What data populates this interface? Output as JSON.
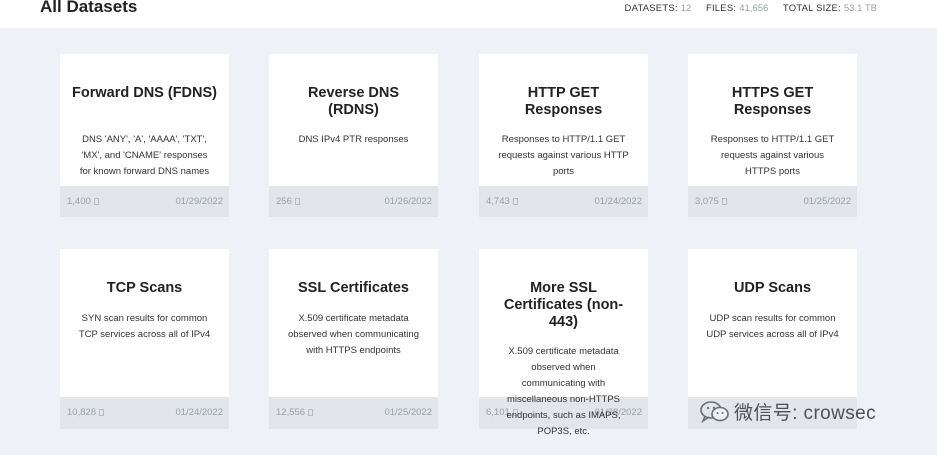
{
  "header": {
    "title": "All Datasets",
    "stats": [
      {
        "label": "DATASETS:",
        "value": "12"
      },
      {
        "label": "FILES:",
        "value": "41,656"
      },
      {
        "label": "TOTAL SIZE:",
        "value": "53.1 TB"
      }
    ]
  },
  "cards": [
    {
      "title": "Forward DNS (FDNS)",
      "description": "DNS 'ANY', 'A', 'AAAA', 'TXT', 'MX', and 'CNAME' responses for known forward DNS names",
      "files": "1,400",
      "date": "01/29/2022"
    },
    {
      "title": "Reverse DNS (RDNS)",
      "description": "DNS IPv4 PTR responses",
      "files": "256",
      "date": "01/26/2022"
    },
    {
      "title": "HTTP GET Responses",
      "description": "Responses to HTTP/1.1 GET requests against various HTTP ports",
      "files": "4,743",
      "date": "01/24/2022"
    },
    {
      "title": "HTTPS GET Responses",
      "description": "Responses to HTTP/1.1 GET requests against various HTTPS ports",
      "files": "3,075",
      "date": "01/25/2022"
    },
    {
      "title": "TCP Scans",
      "description": "SYN scan results for common TCP services across all of IPv4",
      "files": "10,828",
      "date": "01/24/2022"
    },
    {
      "title": "SSL Certificates",
      "description": "X.509 certificate metadata observed when communicating with HTTPS endpoints",
      "files": "12,556",
      "date": "01/25/2022"
    },
    {
      "title": "More SSL Certificates (non-443)",
      "description": "X.509 certificate metadata observed when communicating with miscellaneous non-HTTPS endpoints, such as IMAPS, POP3S, etc.",
      "files": "6,101",
      "date": "01/28/2022"
    },
    {
      "title": "UDP Scans",
      "description": "UDP scan results for common UDP services across all of IPv4",
      "files": "",
      "date": ""
    }
  ],
  "watermark": {
    "text": "微信号: crowsec",
    "icon": "wechat-icon"
  }
}
